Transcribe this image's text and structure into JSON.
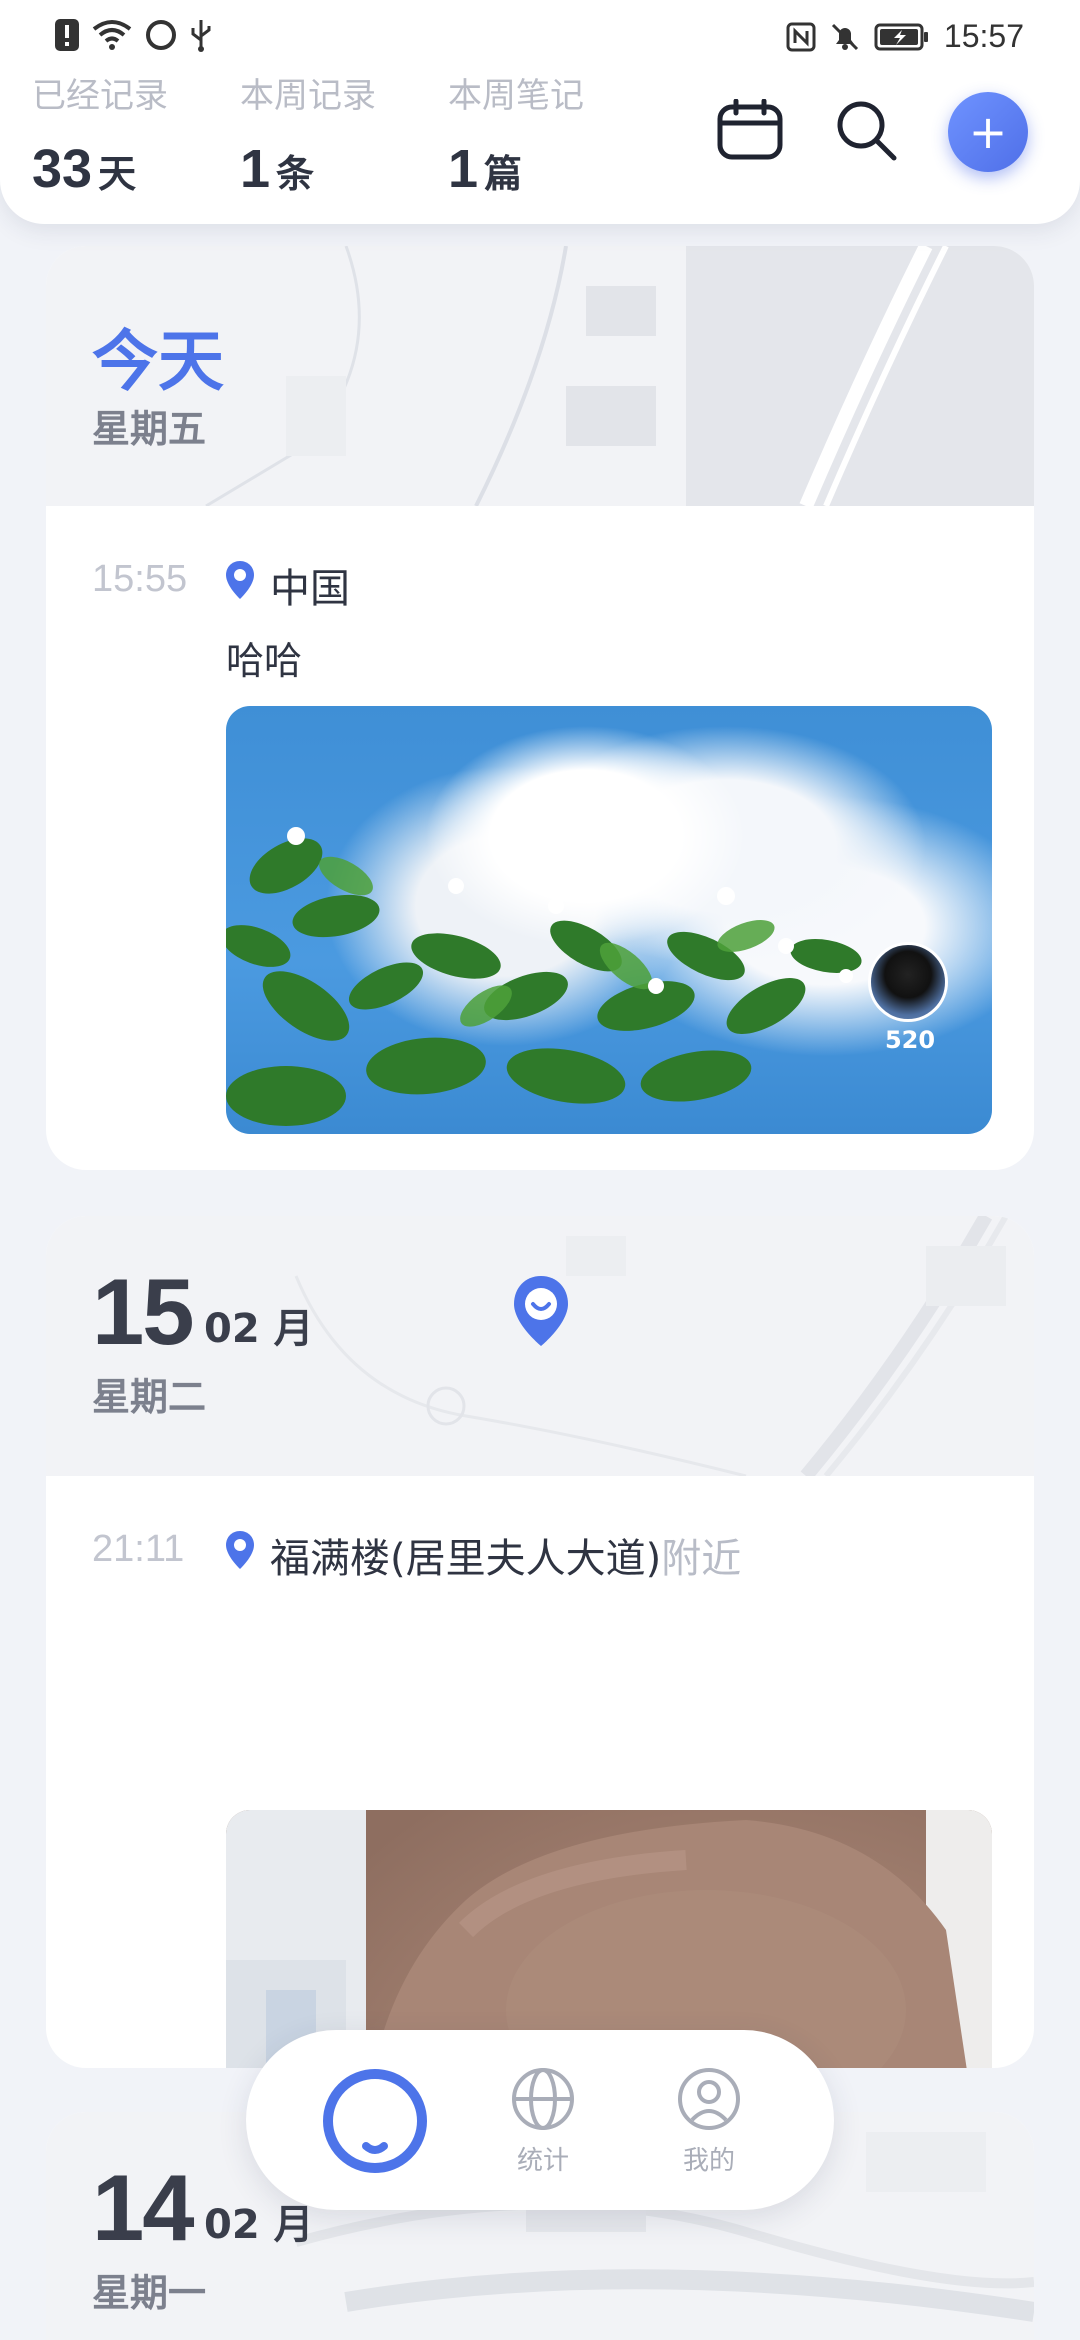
{
  "status_bar": {
    "time": "15:57",
    "left_icons": [
      "alert-icon",
      "wifi-icon",
      "sync-icon",
      "usb-icon"
    ],
    "right_icons": [
      "nfc-icon",
      "mute-bell-icon",
      "battery-charging-icon"
    ]
  },
  "header": {
    "stats": [
      {
        "label": "已经记录",
        "value": "33",
        "unit": "天"
      },
      {
        "label": "本周记录",
        "value": "1",
        "unit": "条"
      },
      {
        "label": "本周笔记",
        "value": "1",
        "unit": "篇"
      }
    ],
    "actions": [
      "calendar-icon",
      "search-icon",
      "add-icon"
    ],
    "add_label": "+"
  },
  "accent_color": "#4d74e9",
  "cards": [
    {
      "date_label": "今天",
      "weekday": "星期五",
      "entries": [
        {
          "time": "15:55",
          "location": "中国",
          "text": "哈哈",
          "photo": "sky-clouds-flowering-branch",
          "avatar_count": "520"
        }
      ]
    },
    {
      "day": "15",
      "month": "02 月",
      "weekday": "星期二",
      "entries": [
        {
          "time": "21:11",
          "location": "福满楼(居里夫人大道)",
          "location_suffix": "附近",
          "photo": "person-back-skin"
        }
      ]
    },
    {
      "day": "14",
      "month": "02 月",
      "weekday": "星期一"
    }
  ],
  "bottom_nav": {
    "items": [
      {
        "icon": "home-smile-icon",
        "label": ""
      },
      {
        "icon": "globe-icon",
        "label": "统计"
      },
      {
        "icon": "user-icon",
        "label": "我的"
      }
    ]
  }
}
